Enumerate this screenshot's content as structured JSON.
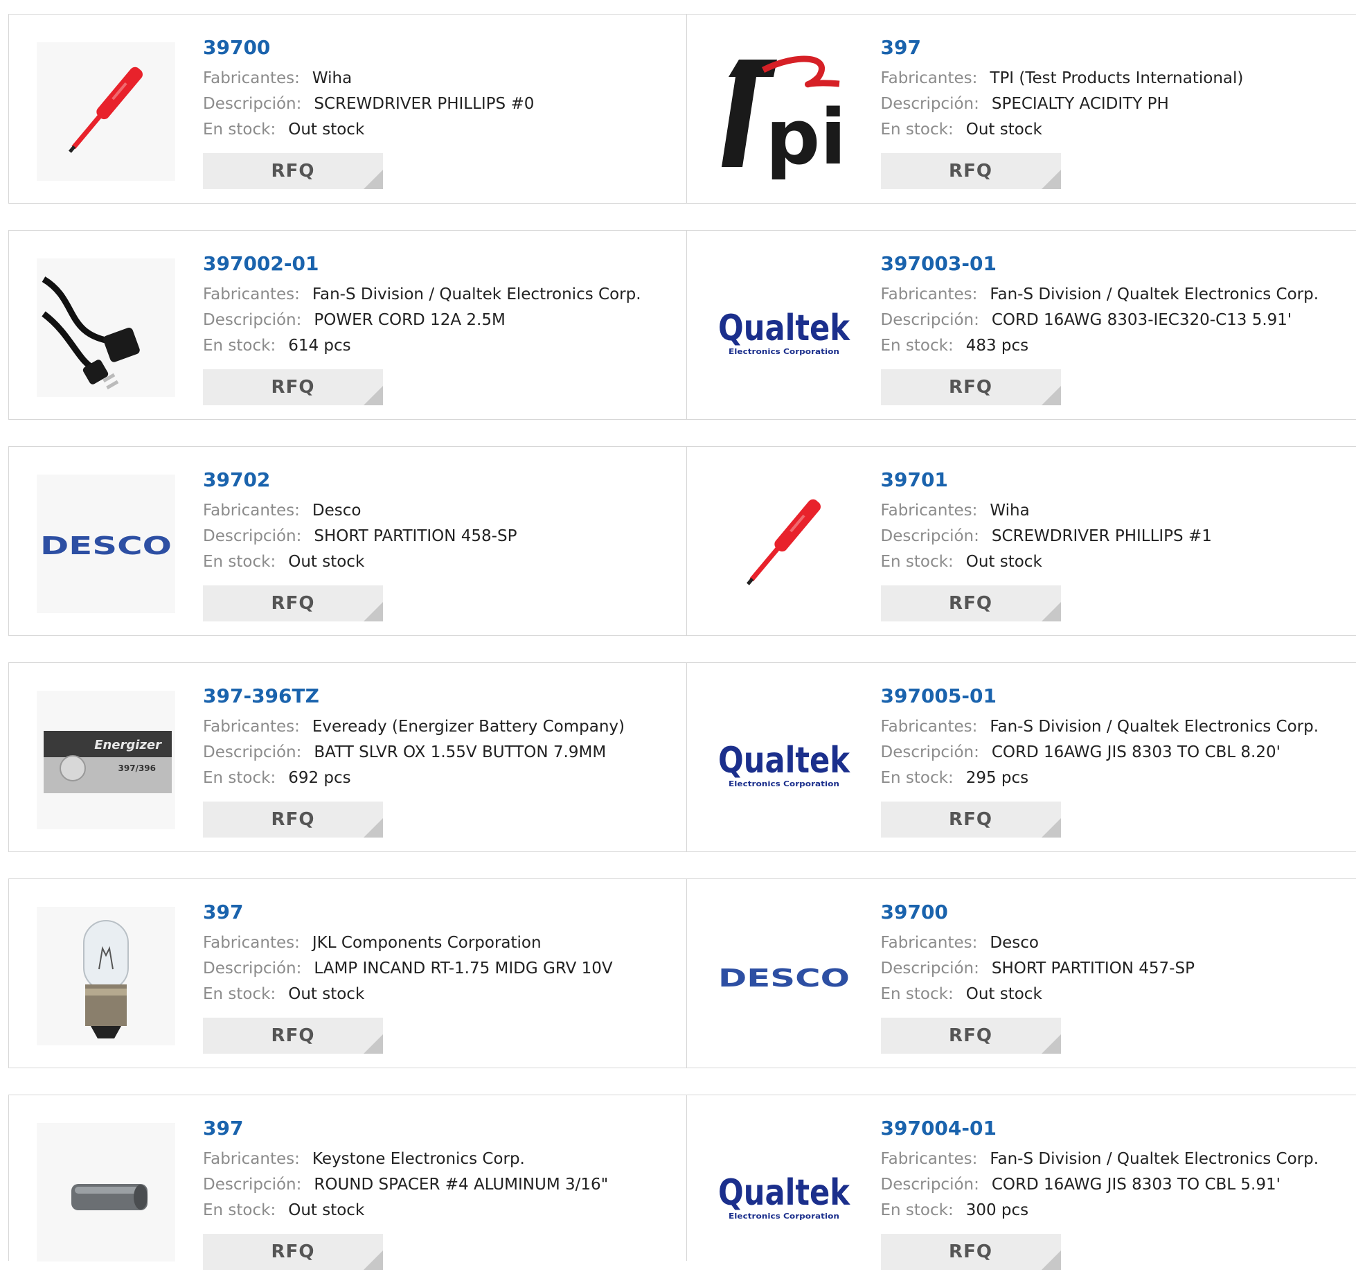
{
  "labels": {
    "manufacturer": "Fabricantes:",
    "description": "Descripción:",
    "stock": "En stock:",
    "rfq": "RFQ"
  },
  "products": [
    {
      "part": "39700",
      "manufacturer": "Wiha",
      "description": "SCREWDRIVER PHILLIPS #0",
      "stock": "Out stock",
      "image": "screwdriver"
    },
    {
      "part": "397",
      "manufacturer": "TPI (Test Products International)",
      "description": "SPECIALTY ACIDITY PH",
      "stock": "Out stock",
      "image": "tpi-logo",
      "logo_text": "tpi"
    },
    {
      "part": "397002-01",
      "manufacturer": "Fan-S Division / Qualtek Electronics Corp.",
      "description": "POWER CORD 12A 2.5M",
      "stock": "614 pcs",
      "image": "power-cord"
    },
    {
      "part": "397003-01",
      "manufacturer": "Fan-S Division / Qualtek Electronics Corp.",
      "description": "CORD 16AWG 8303-IEC320-C13 5.91'",
      "stock": "483 pcs",
      "image": "qualtek-logo",
      "logo_text": "Qualtek",
      "logo_subtext": "Electronics Corporation"
    },
    {
      "part": "39702",
      "manufacturer": "Desco",
      "description": "SHORT PARTITION 458-SP",
      "stock": "Out stock",
      "image": "desco-logo",
      "logo_text": "DESCO"
    },
    {
      "part": "39701",
      "manufacturer": "Wiha",
      "description": "SCREWDRIVER PHILLIPS #1",
      "stock": "Out stock",
      "image": "screwdriver"
    },
    {
      "part": "397-396TZ",
      "manufacturer": "Eveready (Energizer Battery Company)",
      "description": "BATT SLVR OX 1.55V BUTTON 7.9MM",
      "stock": "692 pcs",
      "image": "battery",
      "logo_text": "Energizer",
      "logo_subtext": "397/396"
    },
    {
      "part": "397005-01",
      "manufacturer": "Fan-S Division / Qualtek Electronics Corp.",
      "description": "CORD 16AWG JIS 8303 TO CBL 8.20'",
      "stock": "295 pcs",
      "image": "qualtek-logo",
      "logo_text": "Qualtek",
      "logo_subtext": "Electronics Corporation"
    },
    {
      "part": "397",
      "manufacturer": "JKL Components Corporation",
      "description": "LAMP INCAND RT-1.75 MIDG GRV 10V",
      "stock": "Out stock",
      "image": "lamp"
    },
    {
      "part": "39700",
      "manufacturer": "Desco",
      "description": "SHORT PARTITION 457-SP",
      "stock": "Out stock",
      "image": "desco-logo",
      "logo_text": "DESCO"
    },
    {
      "part": "397",
      "manufacturer": "Keystone Electronics Corp.",
      "description": "ROUND SPACER #4 ALUMINUM 3/16\"",
      "stock": "Out stock",
      "image": "spacer"
    },
    {
      "part": "397004-01",
      "manufacturer": "Fan-S Division / Qualtek Electronics Corp.",
      "description": "CORD 16AWG JIS 8303 TO CBL 5.91'",
      "stock": "300 pcs",
      "image": "qualtek-logo",
      "logo_text": "Qualtek",
      "logo_subtext": "Electronics Corporation"
    }
  ],
  "colors": {
    "part_link": "#1a63ad",
    "label": "#8c8c8c",
    "qualtek": "#1b2f8c",
    "desco": "#2d4fa3",
    "screwdriver": "#e8222b"
  }
}
